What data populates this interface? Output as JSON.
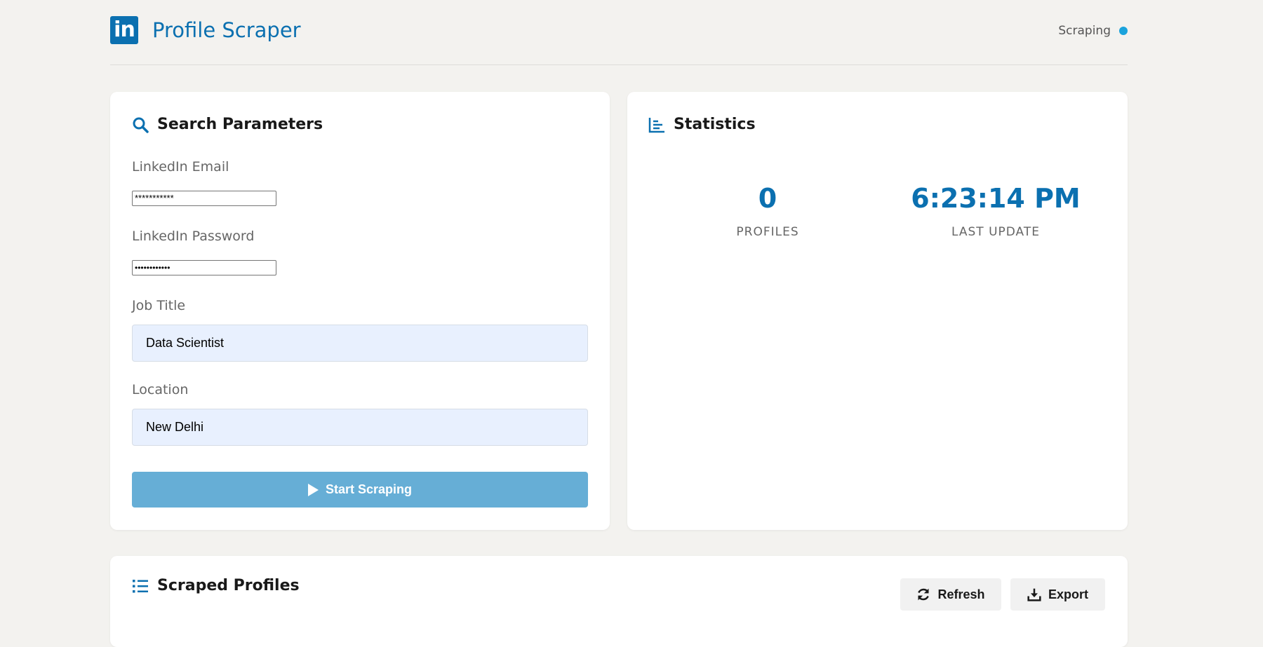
{
  "header": {
    "logo_text": "in",
    "title": "Profile Scraper",
    "status_text": "Scraping",
    "status_color": "#1aa3dc",
    "brand_color": "#0b70b0"
  },
  "search": {
    "title": "Search Parameters",
    "icon": "search-icon",
    "email_label": "LinkedIn Email",
    "email_value": "***********",
    "password_label": "LinkedIn Password",
    "password_value": "••••••••••••",
    "job_title_label": "Job Title",
    "job_title_value": "Data Scientist",
    "location_label": "Location",
    "location_value": "New Delhi",
    "start_button": "Start Scraping"
  },
  "statistics": {
    "title": "Statistics",
    "icon": "chart-icon",
    "profiles_value": "0",
    "profiles_label": "PROFILES",
    "last_update_value": "6:23:14 PM",
    "last_update_label": "LAST UPDATE"
  },
  "profiles": {
    "title": "Scraped Profiles",
    "icon": "list-icon",
    "refresh_button": "Refresh",
    "export_button": "Export"
  }
}
